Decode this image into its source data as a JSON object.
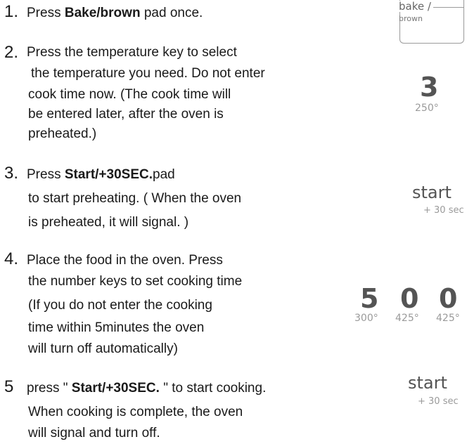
{
  "steps": [
    {
      "number": "1.",
      "lines": [
        {
          "a": "Press ",
          "b": "Bake/brown",
          "c": " pad once."
        }
      ]
    },
    {
      "number": "2.",
      "lines": [
        "Press the temperature key to select",
        "the temperature you need. Do not enter",
        "cook time now. (The cook time will",
        "be entered later, after the oven is",
        "preheated.)"
      ]
    },
    {
      "number": "3.",
      "lines": [
        {
          "a": "Press ",
          "b": "Start/+30SEC.",
          "c": "pad"
        },
        "to start preheating. ( When the oven",
        "is preheated, it will signal. )"
      ]
    },
    {
      "number": "4.",
      "lines": [
        "Place the food in the oven. Press",
        "the number keys to set cooking time",
        "(If you do not enter the cooking",
        "time within 5minutes the oven",
        "will turn off automatically)"
      ]
    },
    {
      "number": "5",
      "lines": [
        {
          "a": "press \" ",
          "b": "Start/+30SEC.",
          "c": " \" to start cooking."
        },
        "When cooking is complete, the oven",
        "will signal and turn off."
      ]
    }
  ],
  "keypad": {
    "bake_label": "bake /",
    "bake_sub": "brown",
    "temp_digit": "3",
    "temp_value": "250°",
    "start1_label": "start",
    "start1_sub": "+ 30 sec",
    "time_digits": [
      "5",
      "0",
      "0"
    ],
    "time_temps": [
      "300°",
      "425°",
      "425°"
    ],
    "start2_label": "start",
    "start2_sub": "+ 30 sec"
  }
}
